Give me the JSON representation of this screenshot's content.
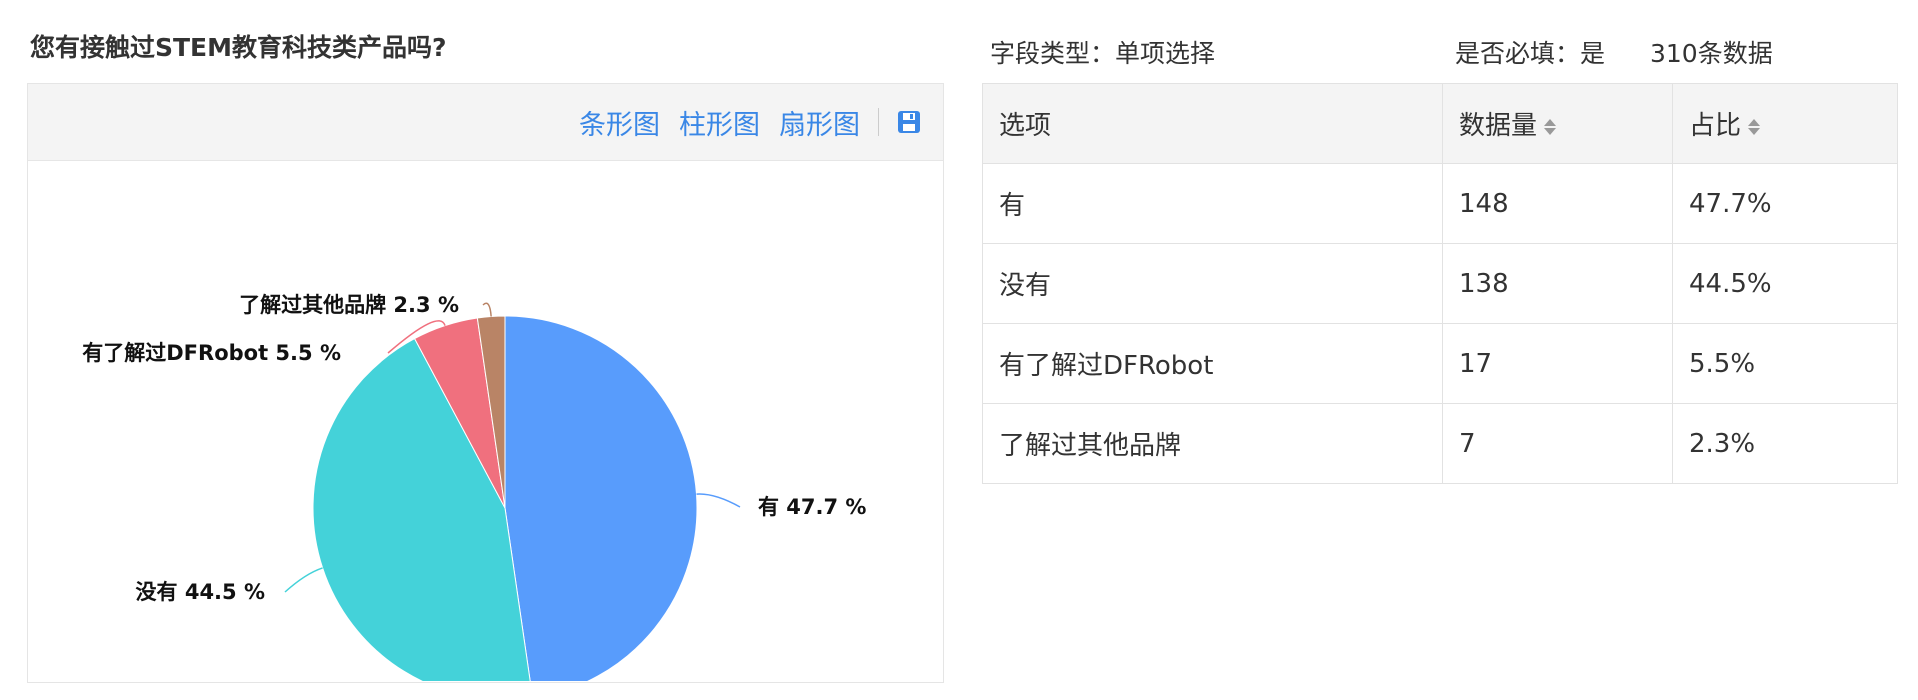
{
  "question": {
    "title": "您有接触过STEM教育科技类产品吗?"
  },
  "toolbar": {
    "bar_label": "条形图",
    "column_label": "柱形图",
    "pie_label": "扇形图",
    "save_icon": "save-icon"
  },
  "meta": {
    "field_type": "字段类型：单项选择",
    "required": "是否必填：是",
    "count": "310条数据"
  },
  "table": {
    "headers": [
      "选项",
      "数据量",
      "占比"
    ],
    "rows": [
      [
        "有",
        "148",
        "47.7%"
      ],
      [
        "没有",
        "138",
        "44.5%"
      ],
      [
        "有了解过DFRobot",
        "17",
        "5.5%"
      ],
      [
        "了解过其他品牌",
        "7",
        "2.3%"
      ]
    ]
  },
  "chart_data": {
    "type": "pie",
    "title": "",
    "categories": [
      "有",
      "没有",
      "有了解过DFRobot",
      "了解过其他品牌"
    ],
    "values": [
      47.7,
      44.5,
      5.5,
      2.3
    ],
    "counts": [
      148,
      138,
      17,
      7
    ],
    "labels": [
      "有 47.7 %",
      "没有 44.5 %",
      "有了解过DFRobot 5.5 %",
      "了解过其他品牌 2.3 %"
    ],
    "colors": [
      "#589cfc",
      "#44d2d9",
      "#f0707e",
      "#b98466"
    ],
    "start_angle": "12 o'clock",
    "direction": "clockwise"
  }
}
